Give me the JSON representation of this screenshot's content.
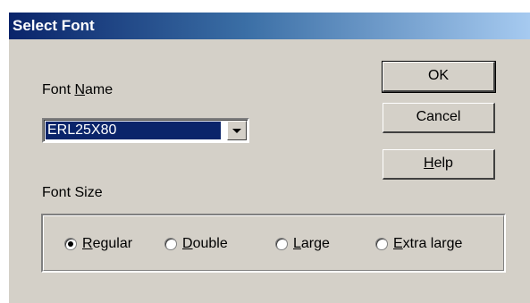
{
  "window": {
    "title": "Select Font"
  },
  "font_name": {
    "label_prefix": "Font ",
    "label_mnemonic": "N",
    "label_rest": "ame",
    "selected_value": "ERL25X80"
  },
  "font_size": {
    "label": "Font Size",
    "options": [
      {
        "mnemonic": "R",
        "rest": "egular",
        "checked": true
      },
      {
        "mnemonic": "D",
        "rest": "ouble",
        "checked": false
      },
      {
        "mnemonic": "L",
        "rest": "arge",
        "checked": false
      },
      {
        "mnemonic": "E",
        "rest": "xtra large",
        "checked": false
      }
    ]
  },
  "buttons": {
    "ok": "OK",
    "cancel": "Cancel",
    "help_mnemonic": "H",
    "help_rest": "elp"
  },
  "colors": {
    "titlebar_start": "#0a246a",
    "titlebar_end": "#a6caf0",
    "dialog_bg": "#d4d0c8",
    "selection": "#0a246a"
  }
}
